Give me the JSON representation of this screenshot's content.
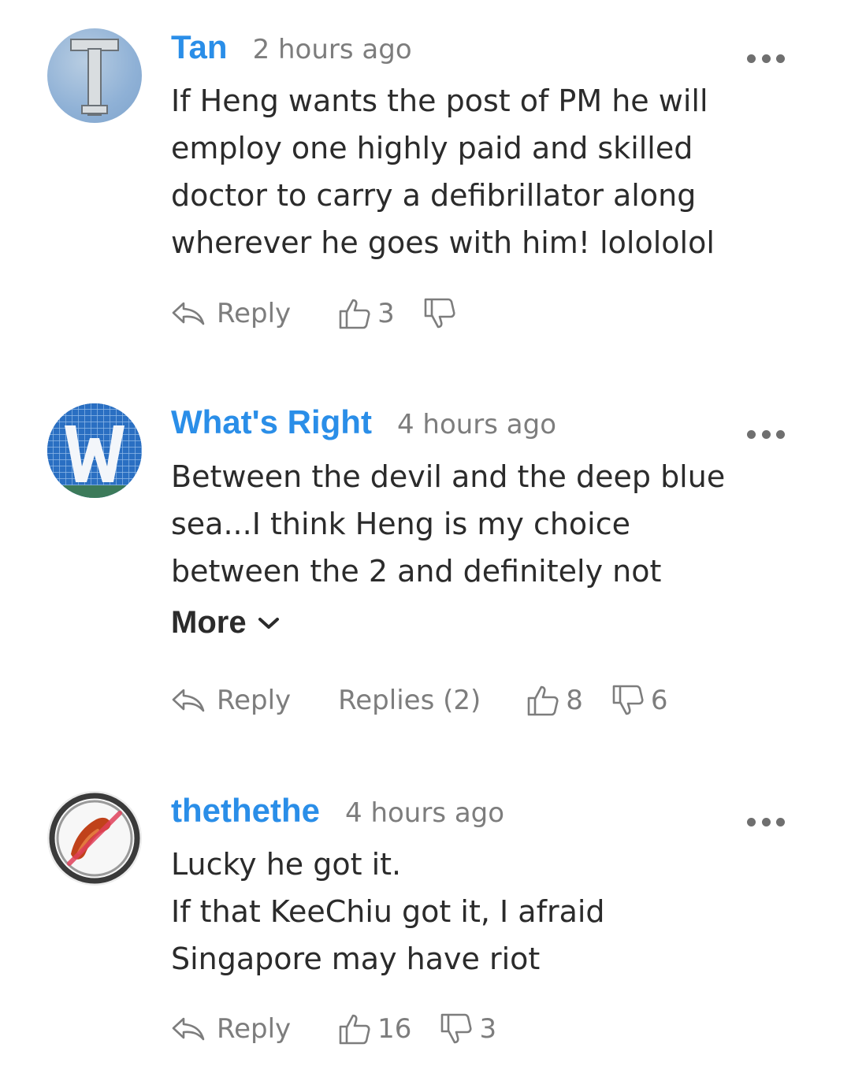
{
  "comments": [
    {
      "author": "Tan",
      "time": "2 hours ago",
      "avatar_letter": "T",
      "lines": [
        "If Heng wants the post of PM he will",
        "employ one highly paid and skilled",
        "doctor to carry a defibrillator along",
        "wherever he goes with him! lolololol"
      ],
      "reply_label": "Reply",
      "likes": "3",
      "dislikes": ""
    },
    {
      "author": "What's Right",
      "time": "4 hours ago",
      "avatar_letter": "W",
      "lines": [
        "Between the devil and the deep blue",
        "sea...I think Heng is my choice",
        "between the 2 and definitely not"
      ],
      "more_label": "More",
      "reply_label": "Reply",
      "replies_label": "Replies (2)",
      "likes": "8",
      "dislikes": "6"
    },
    {
      "author": "thethethe",
      "time": "4 hours ago",
      "avatar_icon": "chicken-wing-no-sign-icon",
      "lines": [
        "Lucky he got it.",
        "If that KeeChiu got it, I afraid",
        "Singapore may have riot"
      ],
      "reply_label": "Reply",
      "likes": "16",
      "dislikes": "3"
    }
  ],
  "colors": {
    "author": "#2a8ee8",
    "body": "#2b2b2b",
    "meta": "#7d7d7d"
  }
}
